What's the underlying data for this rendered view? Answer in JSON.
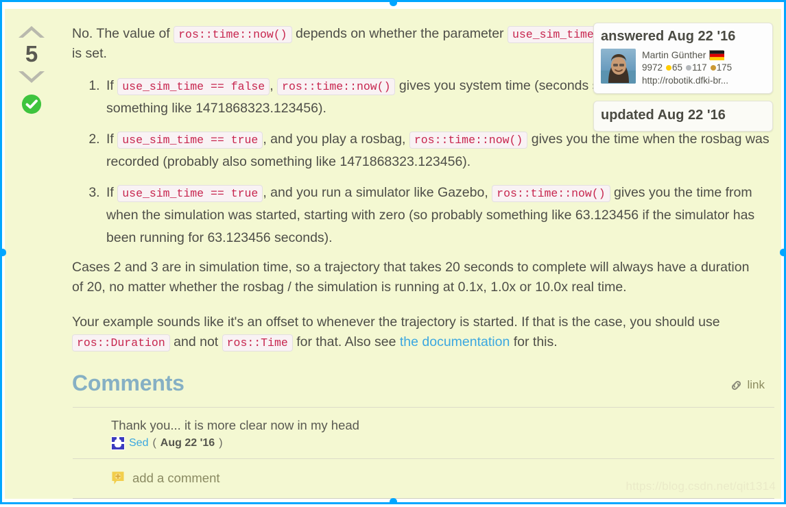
{
  "vote": {
    "upvote_icon": "chevron-up-icon",
    "score": "5",
    "downvote_icon": "chevron-down-icon",
    "accepted_icon": "check-circle-icon"
  },
  "answer": {
    "intro": {
      "before": "No. The value of",
      "code1": "ros::time::now()",
      "middle": "depends on whether the parameter",
      "code2": "use_sim_time",
      "after": "is set."
    },
    "list": [
      {
        "t1": "If",
        "c1": "use_sim_time == false",
        "t2": ",",
        "c2": "ros::time::now()",
        "t3": "gives you system time (seconds since 1970-01-01 0:00, so something like 1471868323.123456)."
      },
      {
        "t1": "If",
        "c1": "use_sim_time == true",
        "t2": ", and you play a rosbag,",
        "c2": "ros::time::now()",
        "t3": "gives you the time when the rosbag was recorded (probably also something like 1471868323.123456)."
      },
      {
        "t1": "If",
        "c1": "use_sim_time == true",
        "t2": ", and you run a simulator like Gazebo,",
        "c2": "ros::time::now()",
        "t3": "gives you the time from when the simulation was started, starting with zero (so probably something like 63.123456 if the simulator has been running for 63.123456 seconds)."
      }
    ],
    "para2": "Cases 2 and 3 are in simulation time, so a trajectory that takes 20 seconds to complete will always have a duration of 20, no matter whether the rosbag / the simulation is running at 0.1x, 1.0x or 10.0x real time.",
    "para3": {
      "before": "Your example sounds like it's an offset to whenever the trajectory is started. If that is the case, you should use",
      "code1": "ros::Duration",
      "middle": "and not",
      "code2": "ros::Time",
      "after_before_link": "for that. Also see",
      "link_text": "the documentation",
      "after": "for this."
    }
  },
  "meta": {
    "answered_title": "answered Aug 22 '16",
    "author_name": "Martin Günther",
    "flag_icon": "flag-germany-icon",
    "avatar_icon": "user-avatar-photo",
    "reputation": "9972",
    "badges_gold": "65",
    "badges_silver": "117",
    "badges_bronze": "175",
    "author_url": "http://robotik.dfki-br...",
    "updated_title": "updated Aug 22 '16"
  },
  "comments_section": {
    "title": "Comments",
    "link_icon": "chain-link-icon",
    "link_label": "link",
    "items": [
      {
        "avatar_icon": "user-avatar-icon",
        "text": "Thank you... it is more clear now in my head",
        "author": "Sed",
        "paren_open": "(",
        "date": "Aug 22 '16",
        "paren_close": ")"
      }
    ],
    "add_comment_icon": "comment-add-icon",
    "add_comment_label": "add a comment"
  },
  "watermark": "https://blog.csdn.net/qit1314",
  "colors": {
    "post_background": "#f4f8d2",
    "selection_blue": "#00a6ff",
    "code_text": "#c7254e",
    "link_blue": "#3ba7e0",
    "comments_heading": "#86b0c4",
    "accepted_green": "#3ec43e",
    "badge_gold": "#ffcc00",
    "badge_silver": "#b4b8bc",
    "badge_bronze": "#cc9933"
  }
}
